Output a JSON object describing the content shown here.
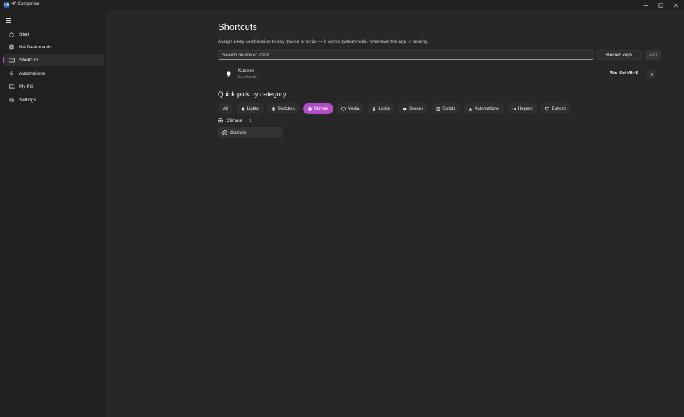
{
  "window": {
    "title": "HA Companion",
    "icon_text": "HA"
  },
  "sidebar": {
    "items": [
      {
        "label": "Start",
        "icon": "home-icon"
      },
      {
        "label": "HA Dashboards",
        "icon": "globe-icon"
      },
      {
        "label": "Shortcuts",
        "icon": "keyboard-icon",
        "active": true
      },
      {
        "label": "Automations",
        "icon": "lightning-icon"
      },
      {
        "label": "My PC",
        "icon": "laptop-icon"
      },
      {
        "label": "Settings",
        "icon": "gear-icon"
      }
    ]
  },
  "page": {
    "title": "Shortcuts",
    "description": "Assign a key combination to any device or script — it works system-wide, whenever the app is running."
  },
  "search": {
    "placeholder": "Search device or script...",
    "value": ""
  },
  "toolbar": {
    "record_label": "Record keys",
    "add_label": "Add"
  },
  "shortcuts": [
    {
      "name": "Kueche",
      "entity": "light.kueche",
      "keys": "Win+Ctrl+Alt+S",
      "icon": "lightbulb-icon"
    }
  ],
  "quick_pick": {
    "title": "Quick pick by category",
    "categories": [
      {
        "label": "All"
      },
      {
        "label": "Lights",
        "icon": "lightbulb-icon"
      },
      {
        "label": "Switches",
        "icon": "switch-icon"
      },
      {
        "label": "Climate",
        "icon": "climate-icon",
        "active": true
      },
      {
        "label": "Media",
        "icon": "media-icon"
      },
      {
        "label": "Locks",
        "icon": "lock-icon"
      },
      {
        "label": "Scenes",
        "icon": "scene-icon"
      },
      {
        "label": "Scripts",
        "icon": "script-icon"
      },
      {
        "label": "Automations",
        "icon": "automation-icon"
      },
      {
        "label": "Helpers",
        "icon": "helper-icon"
      },
      {
        "label": "Buttons",
        "icon": "button-icon"
      }
    ],
    "selected_category": {
      "label": "Climate",
      "count": "1",
      "entities": [
        {
          "label": "Gallerie",
          "icon": "climate-icon"
        }
      ]
    }
  },
  "colors": {
    "accent": "#b14fc8",
    "background": "#202020",
    "content": "#272727"
  }
}
